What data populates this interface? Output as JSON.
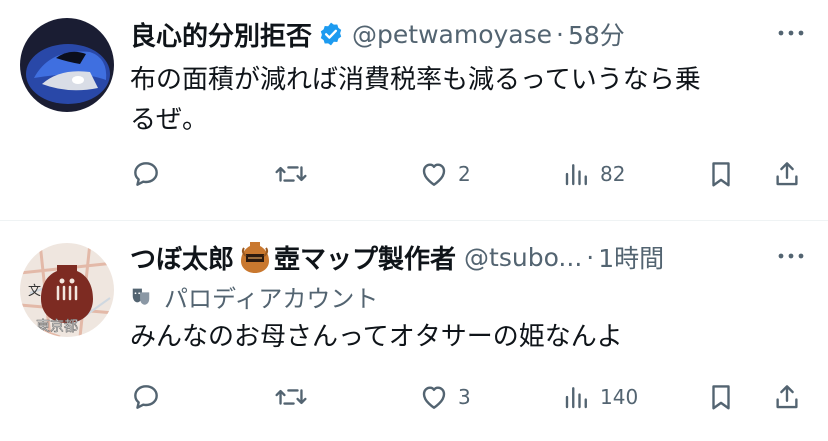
{
  "tweets": [
    {
      "name": "良心的分別拒否",
      "handle": "@petwamoyase",
      "dot": "·",
      "time": "58分",
      "text_lines": [
        "布の面積が減れば消費税率も減るっていうなら乗",
        "るぜ。"
      ],
      "likes": "2",
      "views": "82",
      "verified": true
    },
    {
      "name": "つぼ太郎",
      "name_suffix": "壺マップ製作者",
      "handle": "@tsubo...",
      "dot": "·",
      "time": "1時間",
      "parody_label": "パロディアカウント",
      "avatar_labels": [
        "文",
        "東京都"
      ],
      "text_lines": [
        "みんなのお母さんってオタサーの姫なんよ"
      ],
      "likes": "3",
      "views": "140"
    }
  ],
  "colors": {
    "text": "#0f1419",
    "secondary": "#536471",
    "verified": "#1d9bf0",
    "divider": "#eff3f4"
  },
  "icons": {
    "reply": "reply-icon",
    "retweet": "retweet-icon",
    "like": "heart-icon",
    "views": "views-icon",
    "bookmark": "bookmark-icon",
    "share": "share-icon",
    "more": "more-icon",
    "verified": "verified-badge-icon",
    "parody": "parody-mask-icon",
    "vase_emoji": "amphora-emoji-icon"
  }
}
